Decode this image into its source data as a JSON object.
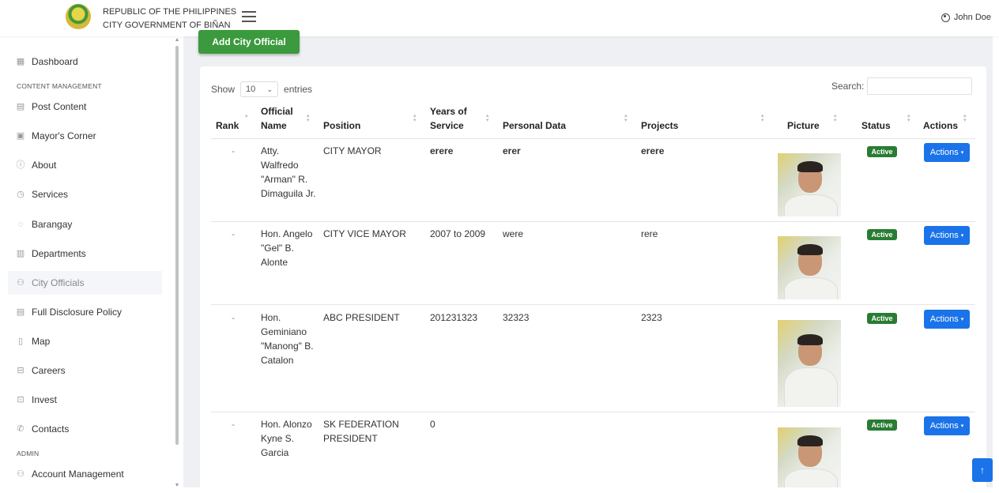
{
  "header": {
    "org_line1": "REPUBLIC OF THE PHILIPPINES",
    "org_line2": "CITY GOVERNMENT OF BIÑAN",
    "user_name": "John Doe"
  },
  "sidebar": {
    "items": [
      {
        "label": "Dashboard",
        "icon": "grid-icon"
      },
      {
        "label": "Post Content",
        "icon": "newspaper-icon"
      },
      {
        "label": "Mayor's Corner",
        "icon": "person-card-icon"
      },
      {
        "label": "About",
        "icon": "info-icon"
      },
      {
        "label": "Services",
        "icon": "gear-circle-icon"
      },
      {
        "label": "Barangay",
        "icon": "map-pin-icon"
      },
      {
        "label": "Departments",
        "icon": "building-icon"
      },
      {
        "label": "City Officials",
        "icon": "people-icon"
      },
      {
        "label": "Full Disclosure Policy",
        "icon": "document-icon"
      },
      {
        "label": "Map",
        "icon": "map-icon"
      },
      {
        "label": "Careers",
        "icon": "briefcase-icon"
      },
      {
        "label": "Invest",
        "icon": "money-icon"
      },
      {
        "label": "Contacts",
        "icon": "phone-icon"
      },
      {
        "label": "Account Management",
        "icon": "users-icon"
      }
    ],
    "section_content": "CONTENT MANAGEMENT",
    "section_admin": "ADMIN",
    "active": "City Officials"
  },
  "main": {
    "add_button": "Add City Official",
    "show_label": "Show",
    "entries_value": "10",
    "entries_label": "entries",
    "search_label": "Search:",
    "columns": {
      "rank": "Rank",
      "name": "Official Name",
      "position": "Position",
      "years": "Years of Service",
      "personal": "Personal Data",
      "projects": "Projects",
      "picture": "Picture",
      "status": "Status",
      "actions": "Actions"
    },
    "rows": [
      {
        "rank": "-",
        "name": "Atty. Walfredo \"Arman\" R. Dimaguila Jr.",
        "position": "CITY MAYOR",
        "years": "erere",
        "personal": "erer",
        "projects": "erere",
        "status": "Active",
        "action": "Actions"
      },
      {
        "rank": "-",
        "name": "Hon. Angelo \"Gel\" B. Alonte",
        "position": "CITY VICE MAYOR",
        "years": "2007 to 2009",
        "personal": "were",
        "projects": "rere",
        "status": "Active",
        "action": "Actions"
      },
      {
        "rank": "-",
        "name": "Hon. Geminiano \"Manong\" B. Catalon",
        "position": "ABC PRESIDENT",
        "years": "201231323",
        "personal": "32323",
        "projects": "2323",
        "status": "Active",
        "action": "Actions"
      },
      {
        "rank": "-",
        "name": "Hon. Alonzo Kyne S. Garcia",
        "position": "SK FEDERATION PRESIDENT",
        "years": "0",
        "personal": "",
        "projects": "",
        "status": "Active",
        "action": "Actions"
      }
    ]
  },
  "colors": {
    "accent_green": "#3a9a3d",
    "badge_green": "#287c33",
    "action_blue": "#1a73e8"
  }
}
